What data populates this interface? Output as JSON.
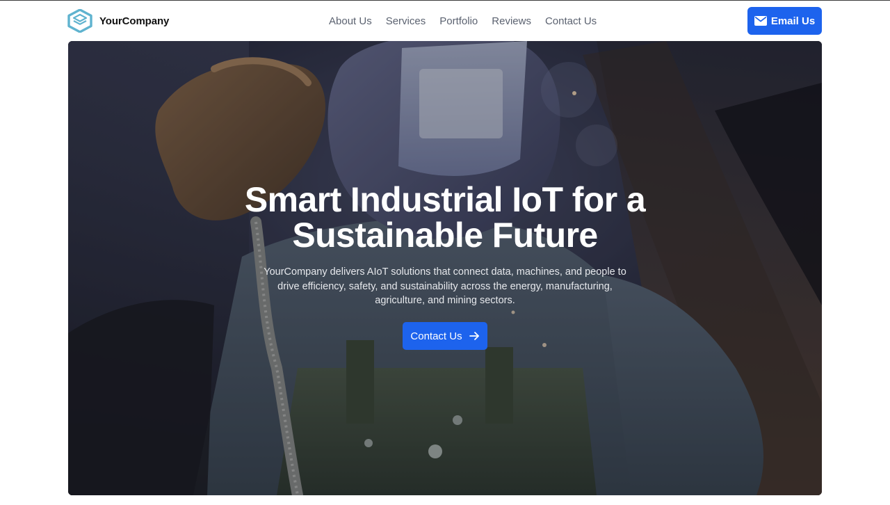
{
  "brand": {
    "name": "YourCompany",
    "logo_icon": "cube-icon",
    "logo_color": "#5fb3cf"
  },
  "nav": {
    "items": [
      {
        "label": "About Us"
      },
      {
        "label": "Services"
      },
      {
        "label": "Portfolio"
      },
      {
        "label": "Reviews"
      },
      {
        "label": "Contact Us"
      }
    ]
  },
  "header_cta": {
    "label": "Email Us",
    "icon": "envelope-icon",
    "color": "#1d63ed"
  },
  "hero": {
    "title": "Smart Industrial IoT for a Sustainable Future",
    "subtitle": "YourCompany delivers AIoT solutions that connect data, machines, and people to drive efficiency, safety, and sustainability across the energy, manufacturing, agriculture, and mining sectors.",
    "cta_label": "Contact Us",
    "cta_icon": "arrow-right-icon",
    "image": "welder-photo"
  }
}
